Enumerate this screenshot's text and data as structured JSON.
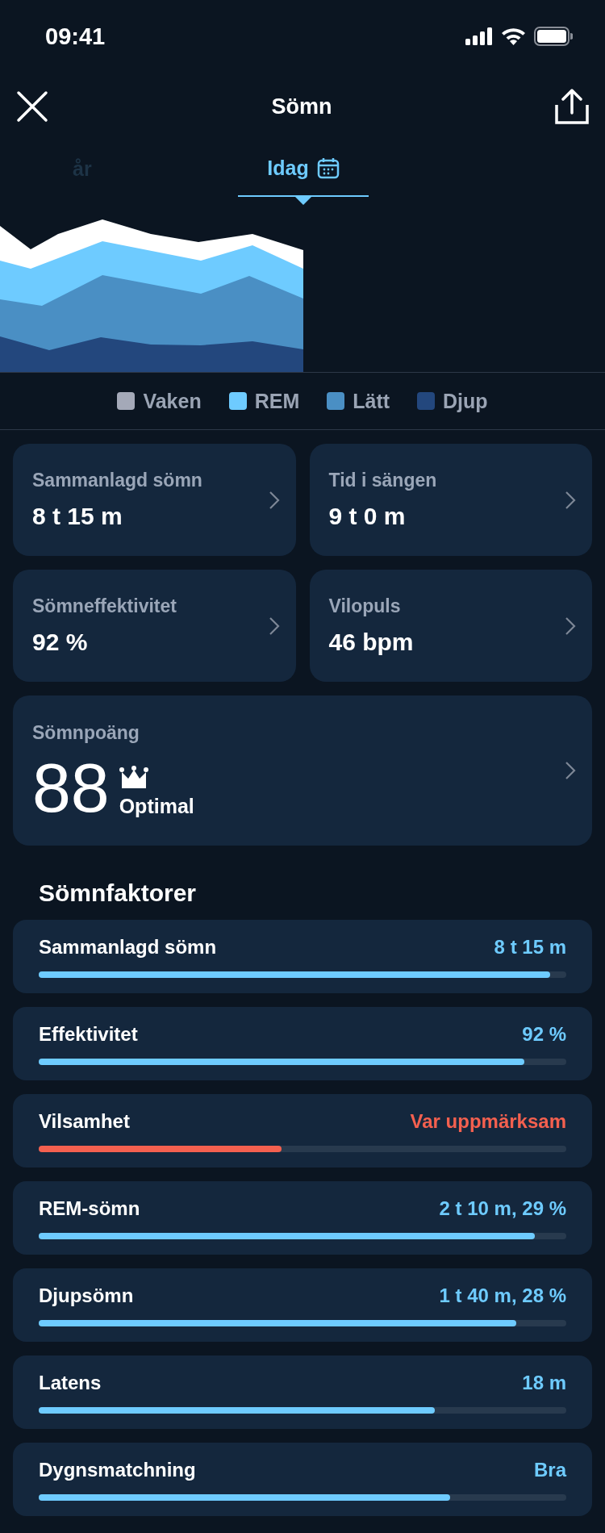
{
  "status_bar": {
    "time": "09:41"
  },
  "nav": {
    "title": "Sömn"
  },
  "tabs": [
    {
      "label": "år",
      "selected": false
    },
    {
      "label": "Idag",
      "selected": true
    }
  ],
  "legend": [
    {
      "label": "Vaken",
      "color": "#a4a9b8"
    },
    {
      "label": "REM",
      "color": "#6ecbff"
    },
    {
      "label": "Lätt",
      "color": "#4a8fc4"
    },
    {
      "label": "Djup",
      "color": "#23477d"
    }
  ],
  "metrics": [
    {
      "label": "Sammanlagd sömn",
      "value": "8 t 15 m"
    },
    {
      "label": "Tid i sängen",
      "value": "9 t 0 m"
    },
    {
      "label": "Sömneffektivitet",
      "value": "92 %"
    },
    {
      "label": "Vilopuls",
      "value": "46 bpm"
    }
  ],
  "score": {
    "label": "Sömnpoäng",
    "value": "88",
    "rating": "Optimal"
  },
  "factors_title": "Sömnfaktorer",
  "factors": [
    {
      "label": "Sammanlagd sömn",
      "value": "8 t 15 m",
      "color": "#6ecbff",
      "level": 0.97
    },
    {
      "label": "Effektivitet",
      "value": "92 %",
      "color": "#6ecbff",
      "level": 0.92
    },
    {
      "label": "Vilsamhet",
      "value": "Var uppmärksam",
      "color": "#f4604f",
      "level": 0.46
    },
    {
      "label": "REM-sömn",
      "value": "2 t 10 m, 29 %",
      "color": "#6ecbff",
      "level": 0.94
    },
    {
      "label": "Djupsömn",
      "value": "1 t 40 m, 28 %",
      "color": "#6ecbff",
      "level": 0.905
    },
    {
      "label": "Latens",
      "value": "18 m",
      "color": "#6ecbff",
      "level": 0.75
    },
    {
      "label": "Dygnsmatchning",
      "value": "Bra",
      "color": "#6ecbff",
      "level": 0.78
    }
  ]
}
